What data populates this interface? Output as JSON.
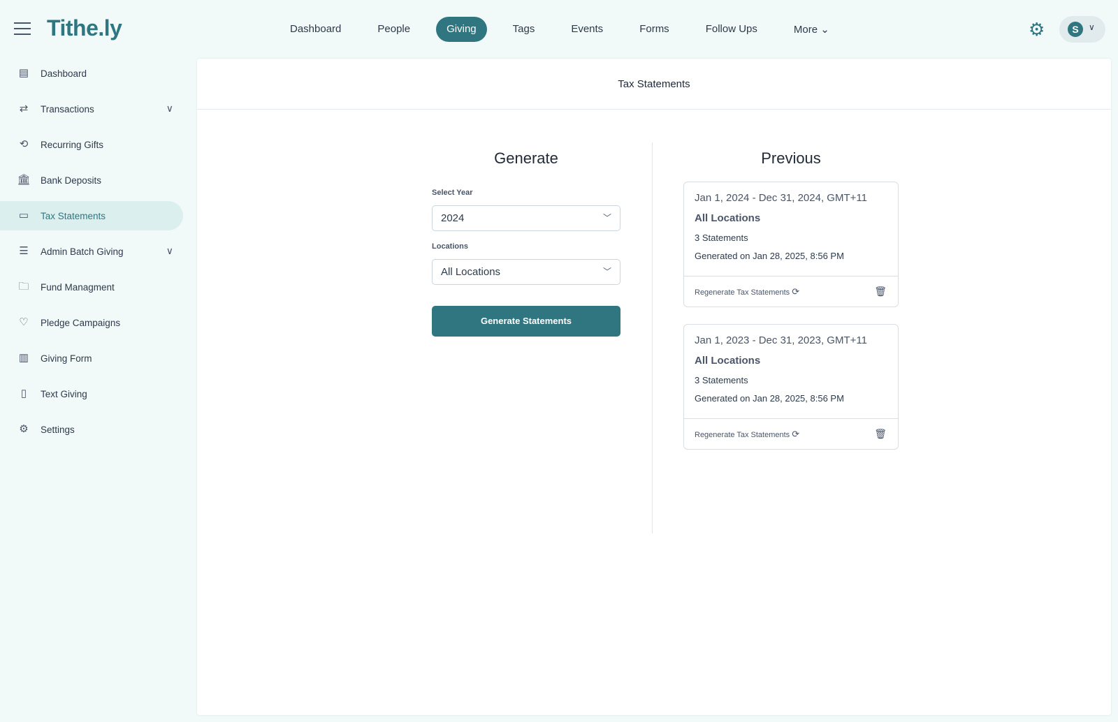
{
  "app": {
    "logo": "Tithe.ly",
    "avatar_initial": "S"
  },
  "nav": [
    "Dashboard",
    "People",
    "Giving",
    "Tags",
    "Events",
    "Forms",
    "Follow Ups",
    "More"
  ],
  "sidebar": [
    {
      "label": "Dashboard",
      "icon": "▤"
    },
    {
      "label": "Transactions",
      "icon": "⇄",
      "expand": true
    },
    {
      "label": "Recurring Gifts",
      "icon": "⟲"
    },
    {
      "label": "Bank Deposits",
      "icon": "🏛"
    },
    {
      "label": "Tax Statements",
      "icon": "▭",
      "active": true
    },
    {
      "label": "Admin Batch Giving",
      "icon": "☰",
      "expand": true
    },
    {
      "label": "Fund Managment",
      "icon": "🗀"
    },
    {
      "label": "Pledge Campaigns",
      "icon": "♡"
    },
    {
      "label": "Giving Form",
      "icon": "▥"
    },
    {
      "label": "Text Giving",
      "icon": "▯"
    },
    {
      "label": "Settings",
      "icon": "⚙"
    }
  ],
  "page": {
    "title": "Tax Statements"
  },
  "generate": {
    "heading": "Generate",
    "year_label": "Select Year",
    "year_value": "2024",
    "locations_label": "Locations",
    "locations_value": "All Locations",
    "button": "Generate Statements"
  },
  "previous": {
    "heading": "Previous",
    "cards": [
      {
        "range": "Jan 1, 2024 - Dec 31, 2024, GMT+11",
        "location": "All Locations",
        "count": "3 Statements",
        "generated": "Generated on Jan 28, 2025, 8:56 PM",
        "regen": "Regenerate Tax Statements"
      },
      {
        "range": "Jan 1, 2023 - Dec 31, 2023, GMT+11",
        "location": "All Locations",
        "count": "3 Statements",
        "generated": "Generated on Jan 28, 2025, 8:56 PM",
        "regen": "Regenerate Tax Statements"
      }
    ]
  },
  "colors": {
    "accent": "#2f7680",
    "bg": "#f1f9f9"
  }
}
